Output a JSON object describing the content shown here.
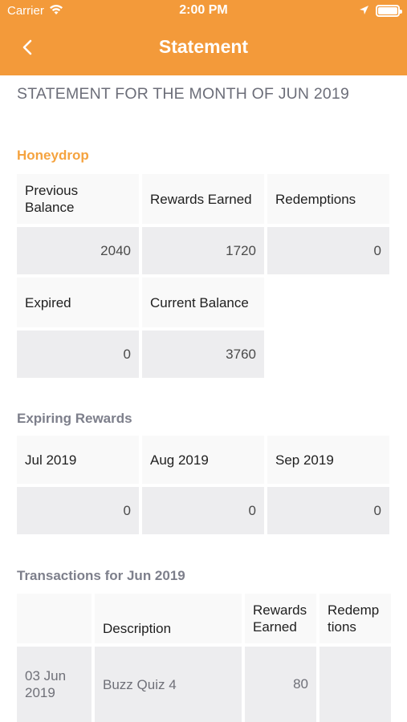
{
  "status_bar": {
    "carrier": "Carrier",
    "time": "2:00 PM"
  },
  "nav": {
    "title": "Statement",
    "back_icon": "chevron-left-icon"
  },
  "heading": "STATEMENT FOR THE MONTH OF JUN 2019",
  "honeydrop": {
    "title": "Honeydrop",
    "headers": [
      "Previous Balance",
      "Rewards Earned",
      "Redemptions"
    ],
    "values": [
      "2040",
      "1720",
      "0"
    ],
    "headers2": [
      "Expired",
      "Current Balance"
    ],
    "values2": [
      "0",
      "3760"
    ]
  },
  "expiring": {
    "title": "Expiring Rewards",
    "headers": [
      "Jul 2019",
      "Aug 2019",
      "Sep 2019"
    ],
    "values": [
      "0",
      "0",
      "0"
    ]
  },
  "transactions": {
    "title": "Transactions for Jun 2019",
    "headers": [
      "",
      "Description",
      "Rewards Earned",
      "Redemp tions"
    ],
    "rows": [
      {
        "date": "03 Jun 2019",
        "description": "Buzz Quiz 4",
        "rewards": "80",
        "redemptions": ""
      }
    ]
  },
  "colors": {
    "accent": "#F39A3A",
    "section_orange": "#F5A33F",
    "section_grey": "#7D7F8B"
  }
}
